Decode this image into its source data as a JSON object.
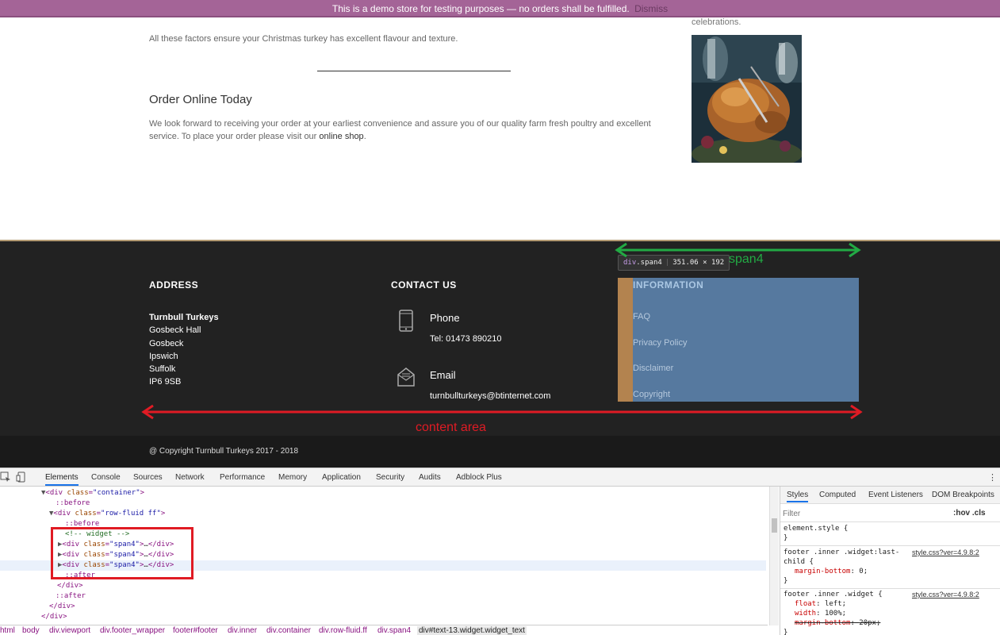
{
  "banner": {
    "text": "This is a demo store for testing purposes — no orders shall be fulfilled.",
    "dismiss": "Dismiss"
  },
  "content": {
    "caption_cut": "celebrations.",
    "para1": "All these factors ensure your Christmas turkey has excellent flavour and texture.",
    "order_heading": "Order Online Today",
    "order_text": "We look forward to receiving your order at your earliest convenience and assure you of our quality farm fresh poultry and excellent service. To place your order please visit our ",
    "order_link": "online shop",
    "order_tail": "."
  },
  "footer": {
    "address": {
      "title": "ADDRESS",
      "name": "Turnbull Turkeys",
      "lines": [
        "Gosbeck Hall",
        "Gosbeck",
        "Ipswich",
        "Suffolk",
        "IP6 9SB"
      ]
    },
    "contact": {
      "title": "CONTACT US",
      "phone_label": "Phone",
      "phone_value": "Tel: 01473 890210",
      "email_label": "Email",
      "email_value": "turnbullturkeys@btinternet.com"
    },
    "information": {
      "title": "INFORMATION",
      "links": [
        "FAQ",
        "Privacy Policy",
        "Disclaimer",
        "Copyright"
      ]
    },
    "copyright": "@ Copyright Turnbull Turkeys 2017 - 2018"
  },
  "inspector_tooltip": {
    "tag": "div",
    "cls": ".span4",
    "size": "351.06 × 192"
  },
  "annotations": {
    "span4": "span4",
    "content_area": "content area",
    "span4_color": "#22aa44",
    "content_color": "#e01b24"
  },
  "devtools": {
    "tabs": [
      "Elements",
      "Console",
      "Sources",
      "Network",
      "Performance",
      "Memory",
      "Application",
      "Security",
      "Audits",
      "Adblock Plus"
    ],
    "active_tab": "Elements",
    "breadcrumb": [
      "html",
      "body",
      "div.viewport",
      "div.footer_wrapper",
      "footer#footer",
      "div.inner",
      "div.container",
      "div.row-fluid.ff",
      "div.span4",
      "div#text-13.widget.widget_text"
    ],
    "styles_tabs": [
      "Styles",
      "Computed",
      "Event Listeners",
      "DOM Breakpoints"
    ],
    "filter_placeholder": "Filter",
    "hov_cls": ":hov  .cls",
    "rules": {
      "element_style": "element.style {",
      "close": "}",
      "rule1_selector": "footer .inner .widget:last-",
      "rule1_selector2": "child {",
      "rule1_src": "style.css?ver=4.9.8:2",
      "rule1_prop": "margin-bottom",
      "rule1_val": "0;",
      "rule2_selector": "footer .inner .widget {",
      "rule2_src": "style.css?ver=4.9.8:2",
      "rule2_p1": "float",
      "rule2_v1": "left;",
      "rule2_p2": "width",
      "rule2_v2": "100%;",
      "rule2_p3": "margin-bottom",
      "rule2_v3": "20px;"
    },
    "dom": {
      "l1_attr": "class",
      "l1_val": "\"container\"",
      "before": "::before",
      "after": "::after",
      "l3_val": "\"row-fluid ff\"",
      "comment": "<!-- widget -->",
      "span_val": "\"span4\"",
      "ellipsis": "…"
    }
  }
}
